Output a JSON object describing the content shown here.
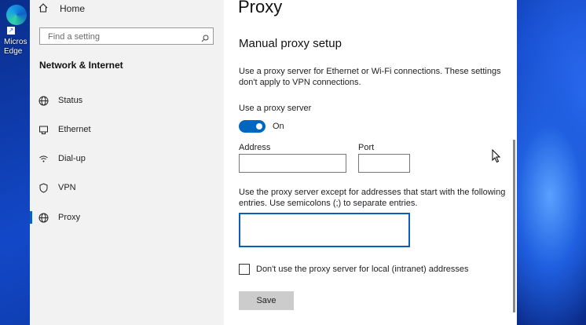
{
  "desktop": {
    "edge_label": "Micros Edge"
  },
  "sidebar": {
    "home_label": "Home",
    "search_placeholder": "Find a setting",
    "section_title": "Network & Internet",
    "items": [
      {
        "label": "Status",
        "icon": "globe-icon"
      },
      {
        "label": "Ethernet",
        "icon": "ethernet-icon"
      },
      {
        "label": "Dial-up",
        "icon": "dialup-icon"
      },
      {
        "label": "VPN",
        "icon": "vpn-icon"
      },
      {
        "label": "Proxy",
        "icon": "proxy-globe-icon",
        "selected": true
      }
    ]
  },
  "main": {
    "title": "Proxy",
    "section_title": "Manual proxy setup",
    "description": "Use a proxy server for Ethernet or Wi-Fi connections. These settings don't apply to VPN connections.",
    "use_proxy_label": "Use a proxy server",
    "toggle_state": "On",
    "address_label": "Address",
    "address_value": "",
    "port_label": "Port",
    "port_value": "",
    "exceptions_description": "Use the proxy server except for addresses that start with the following entries. Use semicolons (;) to separate entries.",
    "exceptions_value": "",
    "local_checkbox_label": "Don't use the proxy server for local (intranet) addresses",
    "local_checkbox_checked": false,
    "save_label": "Save"
  },
  "colors": {
    "accent": "#0067c0",
    "sidebar_bg": "#f2f2f2",
    "save_button_bg": "#cccccc"
  }
}
